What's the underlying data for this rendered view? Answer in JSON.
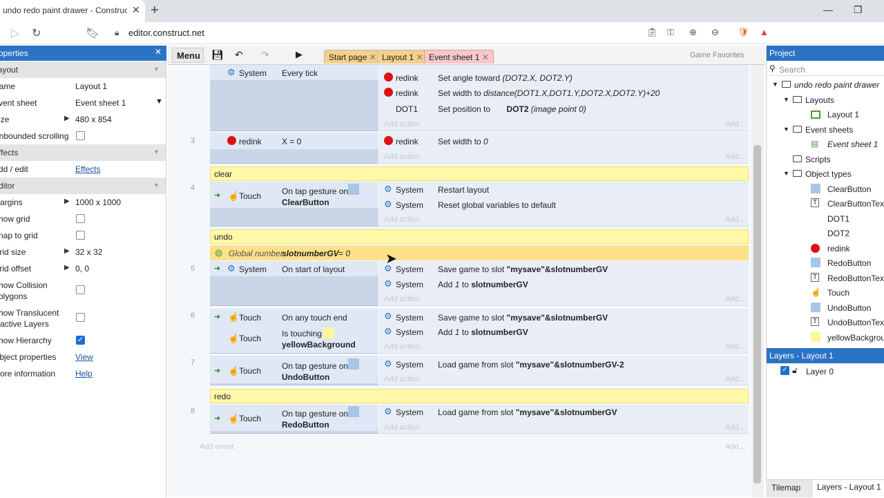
{
  "browser": {
    "tab_title": "undo redo paint drawer - Construct",
    "url": "editor.construct.net"
  },
  "properties": {
    "header": "Properties",
    "rows": [
      {
        "type": "section",
        "label": "Layout"
      },
      {
        "type": "text",
        "label": "Name",
        "value": "Layout 1"
      },
      {
        "type": "select",
        "label": "Event sheet",
        "value": "Event sheet 1"
      },
      {
        "type": "expand",
        "label": "Size",
        "value": "480 x 854"
      },
      {
        "type": "check",
        "label": "Unbounded scrolling",
        "checked": false
      },
      {
        "type": "section",
        "label": "Effects"
      },
      {
        "type": "link",
        "label": "Add / edit",
        "value": "Effects"
      },
      {
        "type": "section",
        "label": "Editor"
      },
      {
        "type": "expand",
        "label": "Margins",
        "value": "1000 x 1000"
      },
      {
        "type": "check",
        "label": "Show grid",
        "checked": false
      },
      {
        "type": "check",
        "label": "Snap to grid",
        "checked": false
      },
      {
        "type": "expand",
        "label": "Grid size",
        "value": "32 x 32"
      },
      {
        "type": "expand",
        "label": "Grid offset",
        "value": "0, 0"
      },
      {
        "type": "check2",
        "label": "Show Collision",
        "label2": "Polygons",
        "checked": false
      },
      {
        "type": "check2",
        "label": "Show Translucent",
        "label2": "Inactive Layers",
        "checked": false
      },
      {
        "type": "check",
        "label": "Show Hierarchy",
        "checked": true
      },
      {
        "type": "link",
        "label": "Object properties",
        "value": "View"
      },
      {
        "type": "link",
        "label": "More information",
        "value": "Help"
      }
    ]
  },
  "toolbar": {
    "menu": "Menu",
    "tabs": [
      "Start page",
      "Layout 1",
      "Event sheet 1"
    ],
    "game_favorites": "Game Favorites"
  },
  "events": {
    "row1_conditions": [
      {
        "obj": "System",
        "text": "Every tick"
      }
    ],
    "row1_actions": [
      {
        "obj": "redink",
        "text": "Set angle toward (DOT2.X, DOT2.Y)"
      },
      {
        "obj": "redink",
        "text": "Set width to distance(DOT1.X,DOT1.Y,DOT2.X,DOT2.Y)+20"
      },
      {
        "obj": "DOT1",
        "text": "Set position to",
        "bold": "DOT2",
        "extra": "(image point 0)"
      }
    ],
    "ev3": {
      "num": "3",
      "cond_obj": "redink",
      "cond": "X = 0",
      "act_obj": "redink",
      "act": "Set width to",
      "act_val": "0"
    },
    "group_clear": "clear",
    "ev4": {
      "num": "4",
      "cond_obj": "Touch",
      "cond": "On tap gesture on",
      "cond_bold": "ClearButton",
      "actions": [
        {
          "obj": "System",
          "text": "Restart layout"
        },
        {
          "obj": "System",
          "text": "Reset global variables to default"
        }
      ]
    },
    "group_undo": "undo",
    "global_var": {
      "prefix": "Global number",
      "name": "slotnumberGV",
      "suffix": "= 0"
    },
    "ev5": {
      "num": "5",
      "cond_obj": "System",
      "cond": "On start of layout",
      "actions": [
        {
          "obj": "System",
          "text": "Save game to slot",
          "bold": "\"mysave\"&slotnumberGV"
        },
        {
          "obj": "System",
          "text": "Add",
          "i": "1",
          "text2": "to",
          "bold": "slotnumberGV"
        }
      ]
    },
    "ev6": {
      "num": "6",
      "cond1_obj": "Touch",
      "cond1": "On any touch end",
      "cond2_obj": "Touch",
      "cond2": "Is touching",
      "cond2_bold": "yellowBackground",
      "actions": [
        {
          "obj": "System",
          "text": "Save game to slot",
          "bold": "\"mysave\"&slotnumberGV"
        },
        {
          "obj": "System",
          "text": "Add",
          "i": "1",
          "text2": "to",
          "bold": "slotnumberGV"
        }
      ]
    },
    "ev7": {
      "num": "7",
      "cond_obj": "Touch",
      "cond": "On tap gesture on",
      "cond_bold": "UndoButton",
      "actions": [
        {
          "obj": "System",
          "text": "Load game from slot",
          "bold": "\"mysave\"&slotnumberGV-2"
        }
      ]
    },
    "group_redo": "redo",
    "ev8": {
      "num": "8",
      "cond_obj": "Touch",
      "cond": "On tap gesture on",
      "cond_bold": "RedoButton",
      "actions": [
        {
          "obj": "System",
          "text": "Load game from slot",
          "bold": "\"mysave\"&slotnumberGV"
        }
      ]
    },
    "add_action": "Add action",
    "add_event": "Add event",
    "add": "Add..."
  },
  "project": {
    "header": "Project",
    "search_placeholder": "Search",
    "tree": [
      "undo redo paint drawer",
      "Layouts",
      "Layout 1",
      "Event sheets",
      "Event sheet 1",
      "Scripts",
      "Object types",
      "ClearButton",
      "ClearButtonText",
      "DOT1",
      "DOT2",
      "redink",
      "RedoButton",
      "RedoButtonText",
      "Touch",
      "UndoButton",
      "UndoButtonText",
      "yellowBackground"
    ],
    "layers_header": "Layers - Layout 1",
    "layer": "Layer 0",
    "bottom_tabs": [
      "Tilemap",
      "Layers - Layout 1"
    ]
  }
}
